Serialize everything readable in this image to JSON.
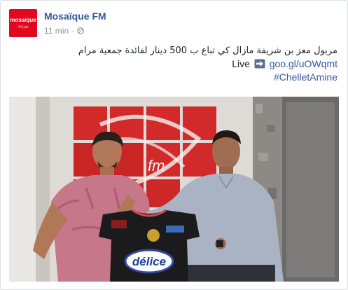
{
  "post": {
    "page_name": "Mosaïque FM",
    "logo_text": "mosaique",
    "logo_subtext": "موزاييك",
    "time": "11 min",
    "separator": "·",
    "privacy_icon": "globe-icon",
    "text_arabic": "مربول معز بن شريفة مازال كي تباع ب 500 دينار لفائدة جمعية مرام",
    "live_label": "Live",
    "arrow_icon": "right-arrow-emoji-icon",
    "link": "goo.gl/uOWqmt",
    "hashtag": "#ChelletAmine",
    "photo": {
      "sponsor_text": "délice",
      "wall_logo_text": "fm"
    }
  },
  "colors": {
    "brand_red": "#e3081f",
    "link_blue": "#365899",
    "meta_gray": "#90949c"
  }
}
